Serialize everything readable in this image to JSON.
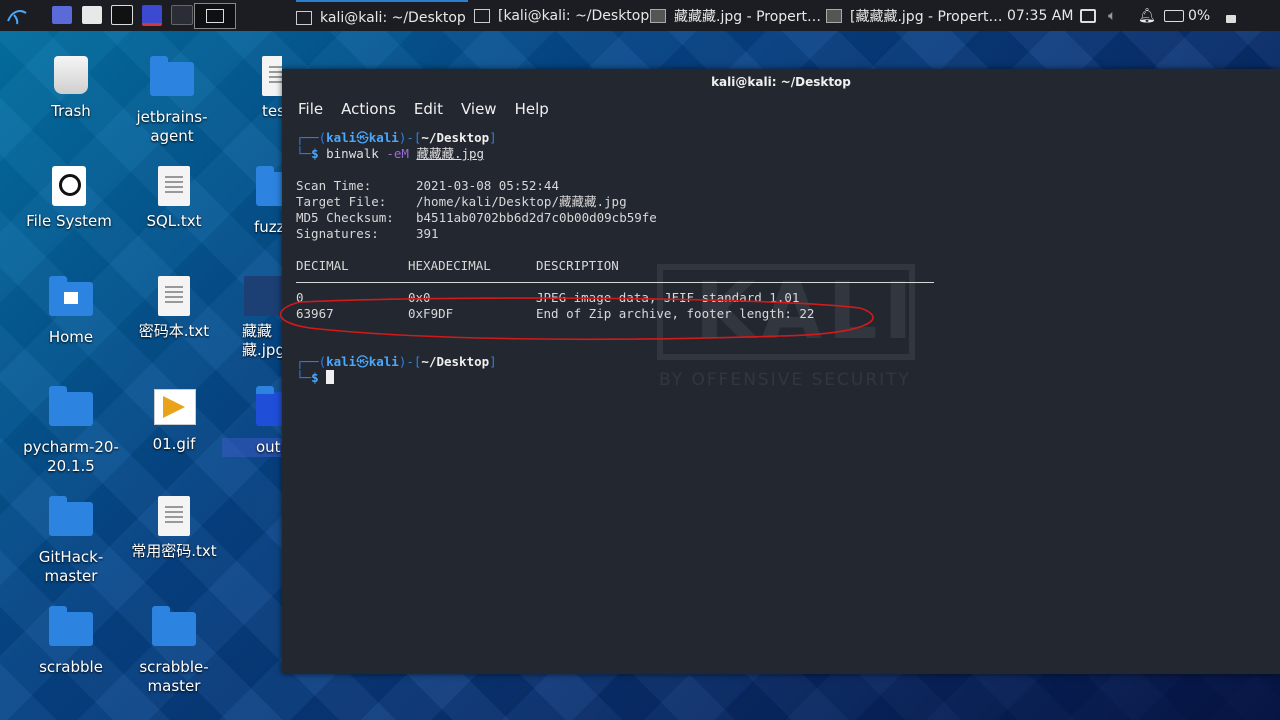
{
  "panel": {
    "tasks": [
      {
        "label": "kali@kali: ~/Desktop",
        "active": true
      },
      {
        "label": "[kali@kali: ~/Desktop]",
        "active": false
      },
      {
        "label": "藏藏藏.jpg - Propert…",
        "active": false
      },
      {
        "label": "[藏藏藏.jpg - Propert…",
        "active": false
      }
    ],
    "clock": "07:35 AM",
    "battery": "0%"
  },
  "desktop": {
    "icons": [
      {
        "label": "Trash",
        "icon": "trash-icon"
      },
      {
        "label": "jetbrains-agent",
        "icon": "folder-icon"
      },
      {
        "label": "tes",
        "icon": "document-icon"
      },
      {
        "label": "File System",
        "icon": "drive-icon"
      },
      {
        "label": "SQL.txt",
        "icon": "document-icon"
      },
      {
        "label": "fuzz",
        "icon": "folder-icon"
      },
      {
        "label": "Home",
        "icon": "home-folder-icon"
      },
      {
        "label": "密码本.txt",
        "icon": "document-icon"
      },
      {
        "label": "藏藏藏.jpg",
        "icon": "image-icon"
      },
      {
        "label": "pycharm-20-20.1.5",
        "icon": "folder-icon"
      },
      {
        "label": "01.gif",
        "icon": "gif-image-icon"
      },
      {
        "label": "output",
        "icon": "folder-icon"
      },
      {
        "label": "GitHack-master",
        "icon": "folder-icon"
      },
      {
        "label": "常用密码.txt",
        "icon": "document-icon"
      },
      {
        "label": "scrabble",
        "icon": "folder-icon"
      },
      {
        "label": "scrabble-master",
        "icon": "folder-icon"
      }
    ]
  },
  "terminal": {
    "title": "kali@kali: ~/Desktop",
    "menu": [
      "File",
      "Actions",
      "Edit",
      "View",
      "Help"
    ],
    "prompt": {
      "user": "kali",
      "host": "kali",
      "at": "㉿",
      "dir": "~/Desktop",
      "symbol": "$"
    },
    "command": {
      "name": "binwalk",
      "flag": "-eM",
      "arg": "藏藏藏.jpg"
    },
    "scan": [
      {
        "key": "Scan Time:",
        "value": "2021-03-08 05:52:44"
      },
      {
        "key": "Target File:",
        "value": "/home/kali/Desktop/藏藏藏.jpg"
      },
      {
        "key": "MD5 Checksum:",
        "value": "b4511ab0702bb6d2d7c0b00d09cb59fe"
      },
      {
        "key": "Signatures:",
        "value": "391"
      }
    ],
    "headers": [
      "DECIMAL",
      "HEXADECIMAL",
      "DESCRIPTION"
    ],
    "rows": [
      [
        "0",
        "0x0",
        "JPEG image data, JFIF standard 1.01"
      ],
      [
        "63967",
        "0xF9DF",
        "End of Zip archive, footer length: 22"
      ]
    ],
    "watermark": {
      "logo": "KALI",
      "tagline": "BY OFFENSIVE SECURITY"
    }
  },
  "colors": {
    "prompt": "#2f7fe0",
    "annotation": "#d11a1a",
    "terminal_bg": "#232730"
  }
}
